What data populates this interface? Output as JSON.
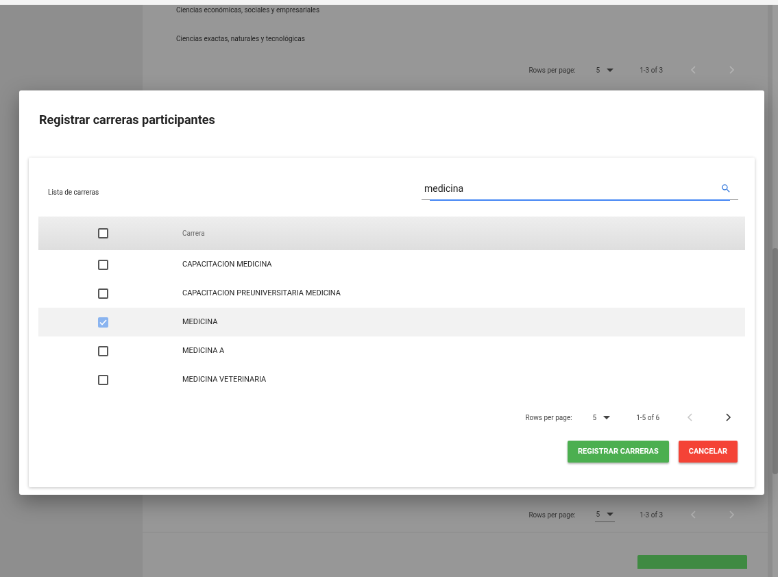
{
  "background": {
    "rows": [
      "Ciencias económicas, sociales y empresariales",
      "Ciencias exactas, naturales y tecnológicas"
    ],
    "pagination_top": {
      "label": "Rows per page:",
      "value": "5",
      "range": "1-3 of 3",
      "prev_disabled": true,
      "next_disabled": true
    },
    "pagination_bottom": {
      "label": "Rows per page:",
      "value": "5",
      "range": "1-3 of 3",
      "prev_disabled": true,
      "next_disabled": true
    }
  },
  "dialog": {
    "title": "Registrar carreras participantes",
    "list_label": "Lista de carreras",
    "search": {
      "value": "medicina"
    },
    "table": {
      "header_checked": false,
      "columns": [
        "Carrera"
      ],
      "rows": [
        {
          "label": "CAPACITACION MEDICINA",
          "checked": false
        },
        {
          "label": "CAPACITACION PREUNIVERSITARIA MEDICINA",
          "checked": false
        },
        {
          "label": "MEDICINA",
          "checked": true
        },
        {
          "label": "MEDICINA A",
          "checked": false
        },
        {
          "label": "MEDICINA VETERINARIA",
          "checked": false
        }
      ]
    },
    "pagination": {
      "label": "Rows per page:",
      "value": "5",
      "range": "1-5 of 6",
      "prev_disabled": true,
      "next_disabled": false
    },
    "buttons": [
      {
        "label": "REGISTRAR CARRERAS",
        "kind": "primary"
      },
      {
        "label": "CANCELAR",
        "kind": "danger"
      }
    ]
  }
}
